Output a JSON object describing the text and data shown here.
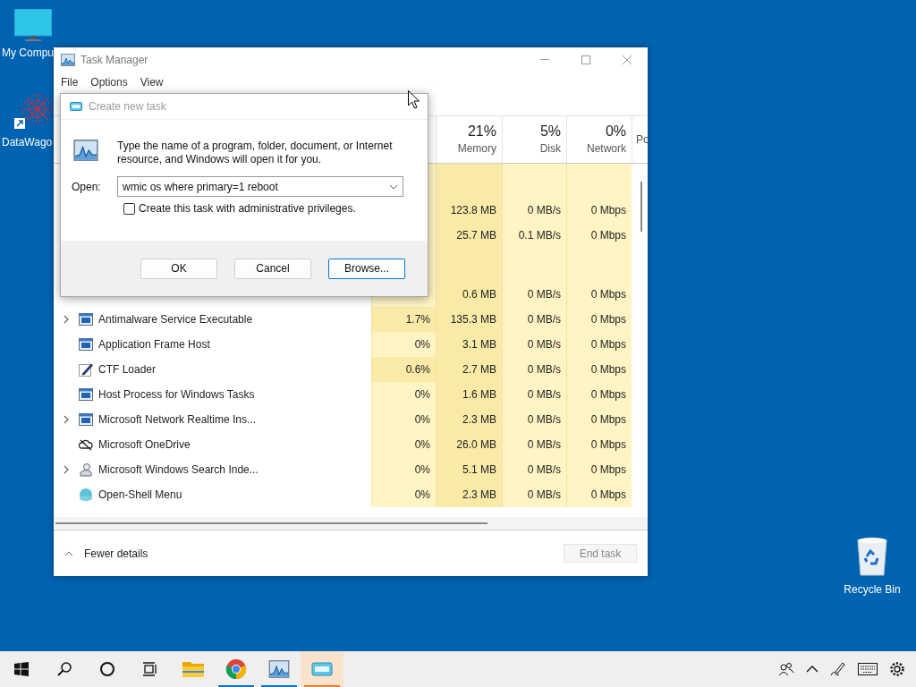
{
  "desktop_icons": [
    {
      "kind": "monitor",
      "label": "My Compu"
    },
    {
      "kind": "shortcut",
      "label": "DataWago"
    },
    {
      "kind": "recycle",
      "label": "Recycle Bin"
    }
  ],
  "task_manager": {
    "title": "Task Manager",
    "menu": [
      "File",
      "Options",
      "View"
    ],
    "columns": [
      {},
      {
        "percent": "21%",
        "label": "Memory"
      },
      {
        "percent": "5%",
        "label": "Disk"
      },
      {
        "percent": "0%",
        "label": "Network"
      },
      {
        "label": "Po"
      }
    ],
    "rows": [
      {
        "kind": "group"
      },
      {
        "kind": "process",
        "memory": "123.8 MB",
        "disk": "0 MB/s",
        "network": "0 Mbps"
      },
      {
        "kind": "process",
        "memory": "25.7 MB",
        "disk": "0.1 MB/s",
        "network": "0 Mbps"
      },
      {
        "kind": "group"
      },
      {
        "kind": "process",
        "memory": "0.6 MB",
        "disk": "0 MB/s",
        "network": "0 Mbps"
      },
      {
        "kind": "process",
        "expandable": true,
        "name": "Antimalware Service Executable",
        "cpu": "1.7%",
        "memory": "135.3 MB",
        "disk": "0 MB/s",
        "network": "0 Mbps"
      },
      {
        "kind": "process",
        "expandable": false,
        "name": "Application Frame Host",
        "cpu": "0%",
        "memory": "3.1 MB",
        "disk": "0 MB/s",
        "network": "0 Mbps"
      },
      {
        "kind": "process",
        "expandable": false,
        "name": "CTF Loader",
        "cpu": "0.6%",
        "memory": "2.7 MB",
        "disk": "0 MB/s",
        "network": "0 Mbps"
      },
      {
        "kind": "process",
        "expandable": false,
        "name": "Host Process for Windows Tasks",
        "cpu": "0%",
        "memory": "1.6 MB",
        "disk": "0 MB/s",
        "network": "0 Mbps"
      },
      {
        "kind": "process",
        "expandable": true,
        "name": "Microsoft Network Realtime Ins...",
        "cpu": "0%",
        "memory": "2.3 MB",
        "disk": "0 MB/s",
        "network": "0 Mbps"
      },
      {
        "kind": "process",
        "expandable": false,
        "name": "Microsoft OneDrive",
        "cpu": "0%",
        "memory": "26.0 MB",
        "disk": "0 MB/s",
        "network": "0 Mbps"
      },
      {
        "kind": "process",
        "expandable": true,
        "name": "Microsoft Windows Search Inde...",
        "cpu": "0%",
        "memory": "5.1 MB",
        "disk": "0 MB/s",
        "network": "0 Mbps"
      },
      {
        "kind": "process",
        "expandable": false,
        "name": "Open-Shell Menu",
        "cpu": "0%",
        "memory": "2.3 MB",
        "disk": "0 MB/s",
        "network": "0 Mbps"
      }
    ],
    "fewer_details": "Fewer details",
    "end_task": {
      "label": "End task",
      "disabled": true
    }
  },
  "dialog": {
    "title": "Create new task",
    "description": "Type the name of a program, folder, document, or Internet resource, and Windows will open it for you.",
    "open_label": "Open:",
    "open_value": "wmic os where primary=1 reboot",
    "admin_checkbox": {
      "label": "Create this task with administrative privileges.",
      "checked": false
    },
    "buttons": [
      {
        "label": "OK",
        "selected": false
      },
      {
        "label": "Cancel",
        "selected": false
      },
      {
        "label": "Browse...",
        "selected": true
      }
    ]
  },
  "taskbar": {
    "items": [
      {
        "kind": "start",
        "running": false,
        "selected": false
      },
      {
        "kind": "search",
        "running": false,
        "selected": false
      },
      {
        "kind": "cortana",
        "running": false,
        "selected": false
      },
      {
        "kind": "taskview",
        "running": false,
        "selected": false
      },
      {
        "kind": "explorer",
        "running": false,
        "selected": false
      },
      {
        "kind": "chrome",
        "running": true,
        "selected": false
      },
      {
        "kind": "taskmanager",
        "running": true,
        "selected": false
      },
      {
        "kind": "run",
        "running": true,
        "selected": true
      }
    ]
  }
}
